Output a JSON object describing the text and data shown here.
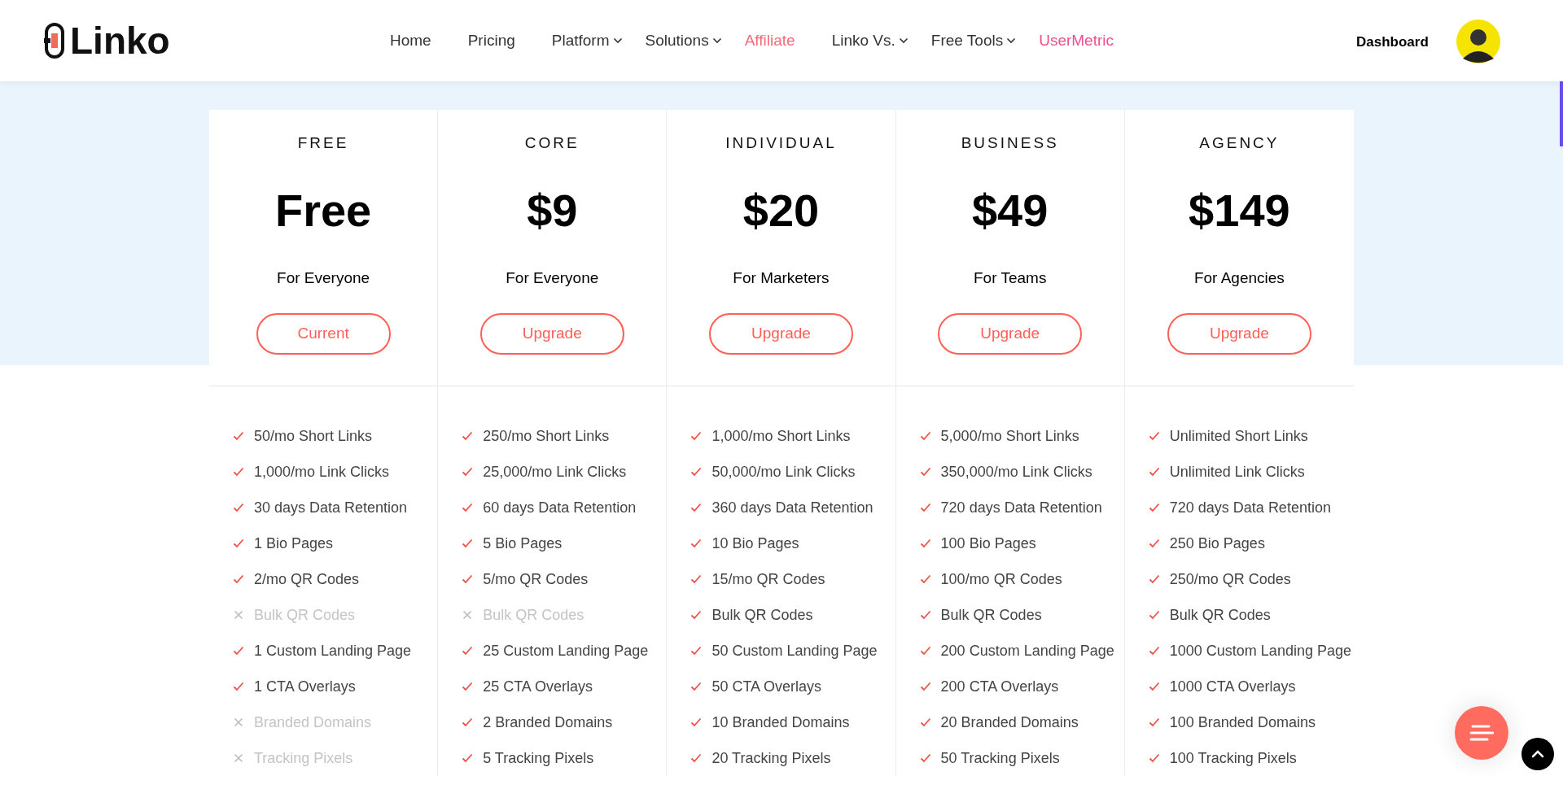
{
  "header": {
    "logo": "Linko",
    "nav": [
      {
        "label": "Home",
        "dropdown": false,
        "highlight": false
      },
      {
        "label": "Pricing",
        "dropdown": false,
        "highlight": false
      },
      {
        "label": "Platform",
        "dropdown": true,
        "highlight": false
      },
      {
        "label": "Solutions",
        "dropdown": true,
        "highlight": false
      },
      {
        "label": "Affiliate",
        "dropdown": false,
        "highlight": true
      },
      {
        "label": "Linko Vs.",
        "dropdown": true,
        "highlight": false
      },
      {
        "label": "Free Tools",
        "dropdown": true,
        "highlight": false
      },
      {
        "label": "UserMetric",
        "dropdown": false,
        "highlight": true
      }
    ],
    "dashboard": "Dashboard"
  },
  "plans": [
    {
      "tier": "FREE",
      "price": "Free",
      "audience": "For Everyone",
      "button": "Current",
      "features": [
        {
          "text": "50/mo Short Links",
          "included": true
        },
        {
          "text": "1,000/mo Link Clicks",
          "included": true
        },
        {
          "text": "30 days Data Retention",
          "included": true
        },
        {
          "text": "1 Bio Pages",
          "included": true
        },
        {
          "text": "2/mo QR Codes",
          "included": true
        },
        {
          "text": "Bulk QR Codes",
          "included": false
        },
        {
          "text": "1 Custom Landing Page",
          "included": true
        },
        {
          "text": "1 CTA Overlays",
          "included": true
        },
        {
          "text": "Branded Domains",
          "included": false
        },
        {
          "text": "Tracking Pixels",
          "included": false
        }
      ]
    },
    {
      "tier": "CORE",
      "price": "$9",
      "audience": "For Everyone",
      "button": "Upgrade",
      "features": [
        {
          "text": "250/mo Short Links",
          "included": true
        },
        {
          "text": "25,000/mo Link Clicks",
          "included": true
        },
        {
          "text": "60 days Data Retention",
          "included": true
        },
        {
          "text": "5 Bio Pages",
          "included": true
        },
        {
          "text": "5/mo QR Codes",
          "included": true
        },
        {
          "text": "Bulk QR Codes",
          "included": false
        },
        {
          "text": "25 Custom Landing Page",
          "included": true
        },
        {
          "text": "25 CTA Overlays",
          "included": true
        },
        {
          "text": "2 Branded Domains",
          "included": true
        },
        {
          "text": "5 Tracking Pixels",
          "included": true
        }
      ]
    },
    {
      "tier": "INDIVIDUAL",
      "price": "$20",
      "audience": "For Marketers",
      "button": "Upgrade",
      "features": [
        {
          "text": "1,000/mo Short Links",
          "included": true
        },
        {
          "text": "50,000/mo Link Clicks",
          "included": true
        },
        {
          "text": "360 days Data Retention",
          "included": true
        },
        {
          "text": "10 Bio Pages",
          "included": true
        },
        {
          "text": "15/mo QR Codes",
          "included": true
        },
        {
          "text": "Bulk QR Codes",
          "included": true
        },
        {
          "text": "50 Custom Landing Page",
          "included": true
        },
        {
          "text": "50 CTA Overlays",
          "included": true
        },
        {
          "text": "10 Branded Domains",
          "included": true
        },
        {
          "text": "20 Tracking Pixels",
          "included": true
        }
      ]
    },
    {
      "tier": "BUSINESS",
      "price": "$49",
      "audience": "For Teams",
      "button": "Upgrade",
      "features": [
        {
          "text": "5,000/mo Short Links",
          "included": true
        },
        {
          "text": "350,000/mo Link Clicks",
          "included": true
        },
        {
          "text": "720 days Data Retention",
          "included": true
        },
        {
          "text": "100 Bio Pages",
          "included": true
        },
        {
          "text": "100/mo QR Codes",
          "included": true
        },
        {
          "text": "Bulk QR Codes",
          "included": true
        },
        {
          "text": "200 Custom Landing Page",
          "included": true
        },
        {
          "text": "200 CTA Overlays",
          "included": true
        },
        {
          "text": "20 Branded Domains",
          "included": true
        },
        {
          "text": "50 Tracking Pixels",
          "included": true
        }
      ]
    },
    {
      "tier": "AGENCY",
      "price": "$149",
      "audience": "For Agencies",
      "button": "Upgrade",
      "features": [
        {
          "text": "Unlimited Short Links",
          "included": true
        },
        {
          "text": "Unlimited Link Clicks",
          "included": true
        },
        {
          "text": "720 days Data Retention",
          "included": true
        },
        {
          "text": "250 Bio Pages",
          "included": true
        },
        {
          "text": "250/mo QR Codes",
          "included": true
        },
        {
          "text": "Bulk QR Codes",
          "included": true
        },
        {
          "text": "1000 Custom Landing Page",
          "included": true
        },
        {
          "text": "1000 CTA Overlays",
          "included": true
        },
        {
          "text": "100 Branded Domains",
          "included": true
        },
        {
          "text": "100 Tracking Pixels",
          "included": true
        }
      ]
    }
  ]
}
